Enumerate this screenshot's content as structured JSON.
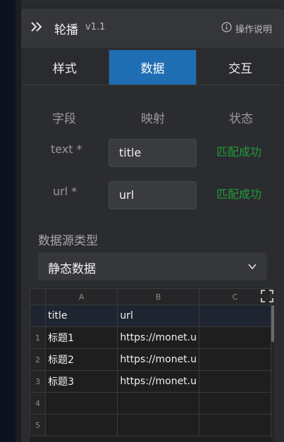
{
  "header": {
    "title": "轮播",
    "version": "v1.1",
    "help_label": "操作说明"
  },
  "tabs": [
    {
      "label": "样式",
      "active": false
    },
    {
      "label": "数据",
      "active": true
    },
    {
      "label": "交互",
      "active": false
    }
  ],
  "mapping": {
    "columns": {
      "field": "字段",
      "mapping": "映射",
      "status": "状态"
    },
    "rows": [
      {
        "field": "text *",
        "value": "title",
        "status": "匹配成功"
      },
      {
        "field": "url *",
        "value": "url",
        "status": "匹配成功"
      }
    ]
  },
  "data_source": {
    "label": "数据源类型",
    "selected": "静态数据"
  },
  "grid": {
    "column_headers": [
      "A",
      "B",
      "C"
    ],
    "header_row": [
      "title",
      "url",
      ""
    ],
    "rows": [
      {
        "num": "1",
        "cells": [
          "标题1",
          "https://monet.u",
          ""
        ]
      },
      {
        "num": "2",
        "cells": [
          "标题2",
          "https://monet.u",
          ""
        ]
      },
      {
        "num": "3",
        "cells": [
          "标题3",
          "https://monet.u",
          ""
        ]
      },
      {
        "num": "4",
        "cells": [
          "",
          "",
          ""
        ]
      },
      {
        "num": "5",
        "cells": [
          "",
          "",
          ""
        ]
      }
    ]
  },
  "colors": {
    "accent": "#1f6db3",
    "success": "#1f9d3a",
    "panel_bg": "#2b2c2f"
  }
}
